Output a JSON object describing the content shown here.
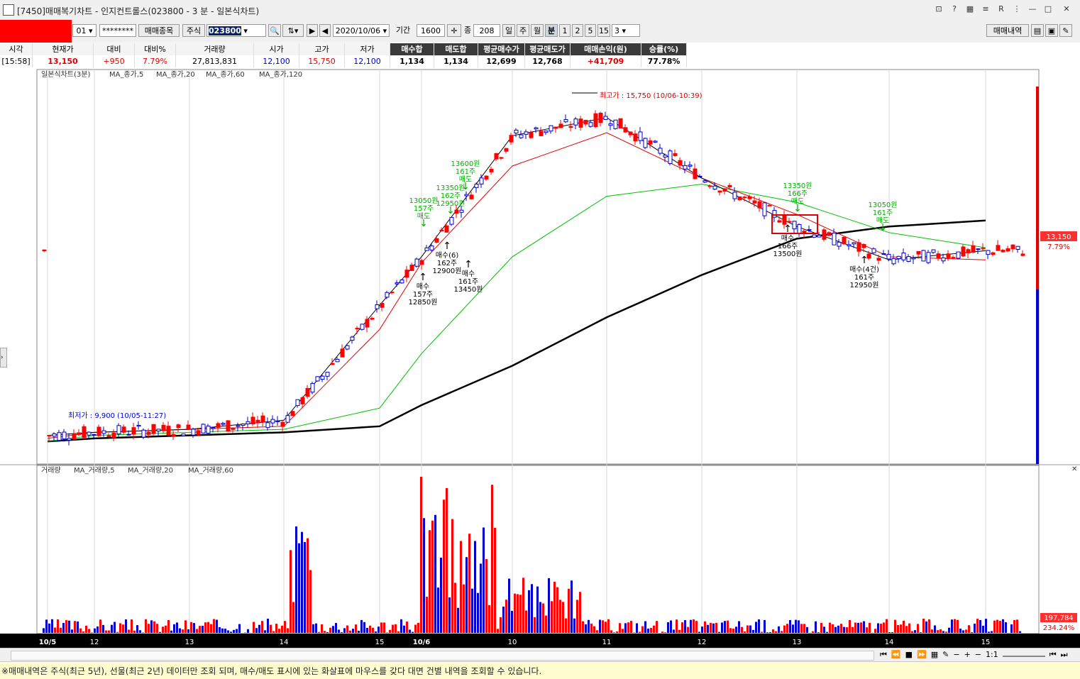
{
  "window": {
    "title": "[7450]매매복기차트 - 인지컨트롤스(023800 - 3 분 - 일본식차트)"
  },
  "toolbar": {
    "account_suffix": "01",
    "password_mask": "********",
    "trade_symbol_btn": "매매종목",
    "market": "주식",
    "code": "023800",
    "date": "2020/10/06",
    "period_label": "기간",
    "period_value": "1600",
    "count_label": "종",
    "count_value": "208",
    "tf_day": "일",
    "tf_week": "주",
    "tf_month": "월",
    "tf_min": "분",
    "tf_1": "1",
    "tf_2": "2",
    "tf_5": "5",
    "tf_15": "15",
    "tf_3": "3",
    "trade_history_btn": "매매내역"
  },
  "quote": {
    "headers": [
      "시각",
      "현재가",
      "대비",
      "대비%",
      "거래량",
      "시가",
      "고가",
      "저가",
      "매수합",
      "매도합",
      "평균매수가",
      "평균매도가",
      "매매손익(원)",
      "승률(%)"
    ],
    "values": [
      "[15:58]",
      "13,150",
      "+950",
      "7.79%",
      "27,813,831",
      "12,100",
      "15,750",
      "12,100",
      "1,134",
      "1,134",
      "12,699",
      "12,768",
      "+41,709",
      "77.78%"
    ]
  },
  "price_chart": {
    "legend_title": "일본식차트(3분)",
    "legend_ma5": "MA_종가,5",
    "legend_ma20": "MA_종가,20",
    "legend_ma60": "MA_종가,60",
    "legend_ma120": "MA_종가,120",
    "high_label": "최고가 : 15,750 (10/06-10:39)",
    "low_label": "최저가 : 9,900 (10/05-11:27)",
    "current_price_tag": "13,150",
    "current_pct_tag": "7.79%"
  },
  "volume_chart": {
    "legend_title": "거래량",
    "legend_ma5": "MA_거래량,5",
    "legend_ma20": "MA_거래량,20",
    "legend_ma60": "MA_거래량,60",
    "current_vol_tag": "197,784",
    "current_pct_tag": "234.24%"
  },
  "x_axis": {
    "labels": [
      "10/5",
      "12",
      "13",
      "14",
      "15",
      "10/6",
      "10",
      "11",
      "12",
      "13",
      "14",
      "15"
    ]
  },
  "annotations": {
    "buy1": [
      "매수",
      "157주",
      "12850원"
    ],
    "buy2": [
      "매수(6)",
      "162주",
      "12900원"
    ],
    "buy3": [
      "매수",
      "161주",
      "13450원"
    ],
    "buy4": [
      "매수",
      "166주",
      "13500원"
    ],
    "buy5": [
      "매수(4건)",
      "161주",
      "12950원"
    ],
    "sell1": [
      "13050원",
      "157주",
      "매도"
    ],
    "sell2": [
      "13350원",
      "162주",
      "12950원"
    ],
    "sell3": [
      "13600원",
      "161주",
      "매도"
    ],
    "sell4": [
      "13350원",
      "166주",
      "매도"
    ],
    "sell5": [
      "13050원",
      "161주",
      "매도"
    ]
  },
  "status": {
    "text": "※매매내역은 주식(최근 5년), 선물(최근 2년) 데이터만 조회 되며, 매수/매도 표시에 있는 화살표에 마우스를 갖다 대면 건별 내역을 조회할 수 있습니다."
  },
  "scrollbar": {
    "zoom_label": "1:1"
  },
  "colors": {
    "up": "#ff0000",
    "down": "#0000ff",
    "ma5": "#000000",
    "ma20": "#e00000",
    "ma60": "#00c000",
    "ma120": "#000000"
  },
  "chart_data": {
    "type": "candlestick",
    "title": "일본식차트(3분)",
    "x": [
      "10/5",
      "12",
      "13",
      "14",
      "15",
      "10/6",
      "10",
      "11",
      "12",
      "13",
      "14",
      "15"
    ],
    "series": [
      {
        "name": "MA_종가,120",
        "values": [
          9950,
          10000,
          10050,
          10100,
          10200,
          10550,
          11200,
          12000,
          12700,
          13300,
          13500,
          13600
        ]
      },
      {
        "name": "MA_종가,60",
        "values": [
          9950,
          10050,
          10100,
          10150,
          10500,
          11400,
          13000,
          14000,
          14200,
          13900,
          13400,
          13150
        ]
      },
      {
        "name": "MA_종가,20",
        "values": [
          10000,
          10100,
          10150,
          10200,
          11800,
          12900,
          14500,
          15050,
          14300,
          13700,
          13000,
          12950
        ]
      },
      {
        "name": "MA_종가,5",
        "values": [
          10050,
          10100,
          10150,
          10300,
          12200,
          13000,
          15000,
          15300,
          14300,
          13500,
          12950,
          13100
        ]
      }
    ],
    "ylim": [
      9600,
      16000
    ],
    "volume": {
      "peak_label": "197,784",
      "peak_pct": "234.24%"
    }
  }
}
